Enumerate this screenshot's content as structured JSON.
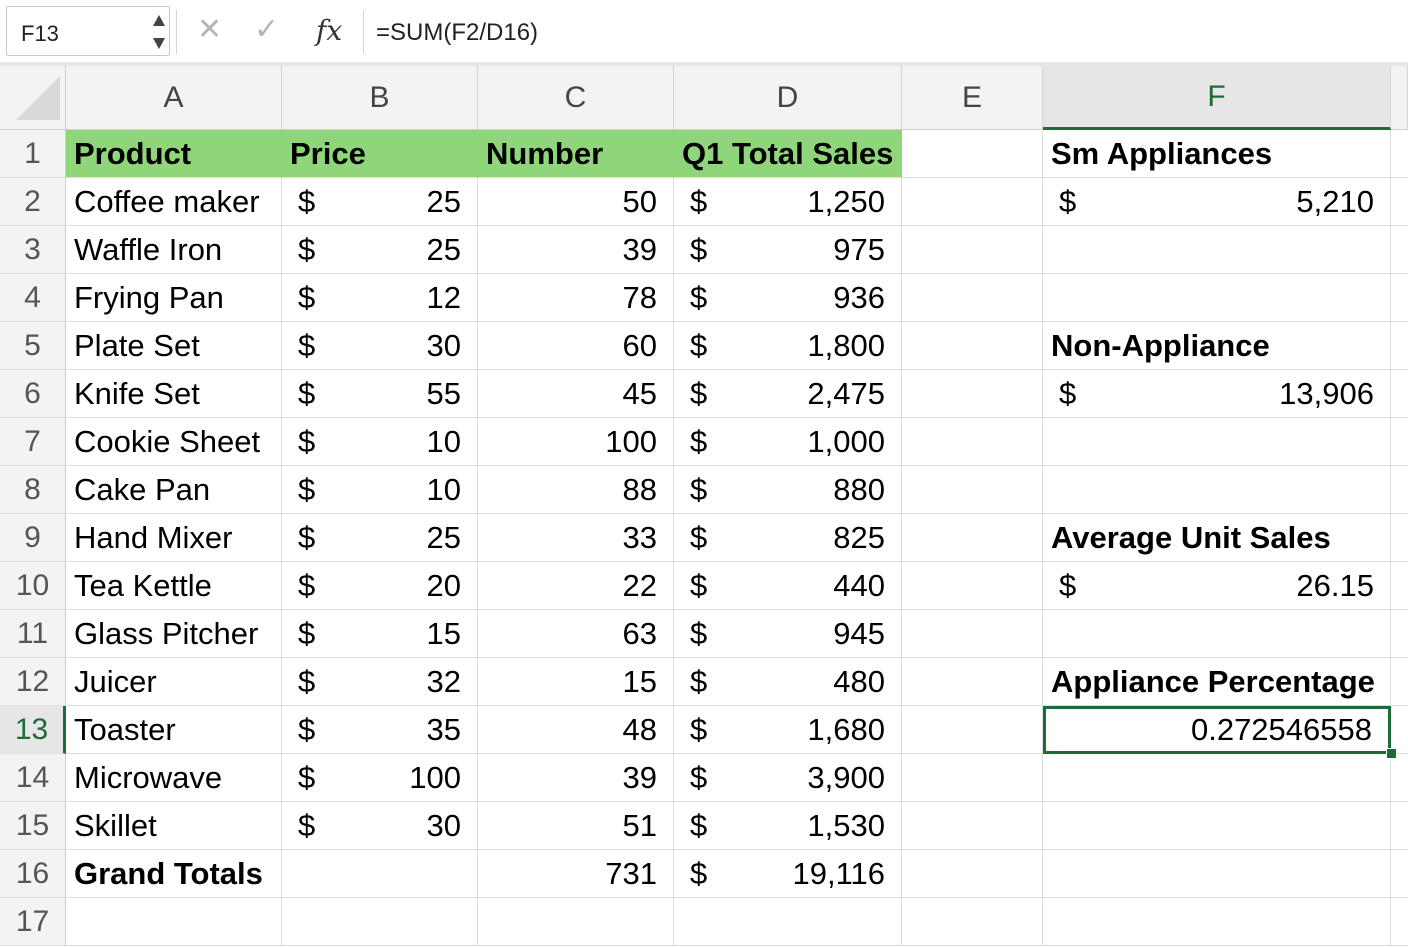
{
  "formula_bar": {
    "name_box": "F13",
    "cancel_icon": "✕",
    "confirm_icon": "✓",
    "fx_label": "fx",
    "formula": "=SUM(F2/D16)"
  },
  "columns": [
    "A",
    "B",
    "C",
    "D",
    "E",
    "F"
  ],
  "rows": [
    "1",
    "2",
    "3",
    "4",
    "5",
    "6",
    "7",
    "8",
    "9",
    "10",
    "11",
    "12",
    "13",
    "14",
    "15",
    "16",
    "17"
  ],
  "header_row": {
    "a": "Product",
    "b": "Price",
    "c": "Number",
    "d": "Q1 Total Sales"
  },
  "products": [
    {
      "name": "Coffee maker",
      "cur": "$",
      "price": "25",
      "number": "50",
      "sales": "1,250"
    },
    {
      "name": "Waffle Iron",
      "cur": "$",
      "price": "25",
      "number": "39",
      "sales": "975"
    },
    {
      "name": "Frying Pan",
      "cur": "$",
      "price": "12",
      "number": "78",
      "sales": "936"
    },
    {
      "name": "Plate Set",
      "cur": "$",
      "price": "30",
      "number": "60",
      "sales": "1,800"
    },
    {
      "name": "Knife Set",
      "cur": "$",
      "price": "55",
      "number": "45",
      "sales": "2,475"
    },
    {
      "name": "Cookie Sheet",
      "cur": "$",
      "price": "10",
      "number": "100",
      "sales": "1,000"
    },
    {
      "name": "Cake Pan",
      "cur": "$",
      "price": "10",
      "number": "88",
      "sales": "880"
    },
    {
      "name": "Hand Mixer",
      "cur": "$",
      "price": "25",
      "number": "33",
      "sales": "825"
    },
    {
      "name": "Tea Kettle",
      "cur": "$",
      "price": "20",
      "number": "22",
      "sales": "440"
    },
    {
      "name": "Glass Pitcher",
      "cur": "$",
      "price": "15",
      "number": "63",
      "sales": "945"
    },
    {
      "name": "Juicer",
      "cur": "$",
      "price": "32",
      "number": "15",
      "sales": "480"
    },
    {
      "name": "Toaster",
      "cur": "$",
      "price": "35",
      "number": "48",
      "sales": "1,680"
    },
    {
      "name": "Microwave",
      "cur": "$",
      "price": "100",
      "number": "39",
      "sales": "3,900"
    },
    {
      "name": "Skillet",
      "cur": "$",
      "price": "30",
      "number": "51",
      "sales": "1,530"
    }
  ],
  "totals": {
    "label": "Grand Totals",
    "number": "731",
    "cur": "$",
    "sales": "19,116"
  },
  "summary": {
    "sm_appliances_label": "Sm Appliances",
    "sm_appliances_cur": "$",
    "sm_appliances_value": "5,210",
    "non_appliance_label": "Non-Appliance",
    "non_appliance_cur": "$",
    "non_appliance_value": "13,906",
    "avg_unit_label": "Average Unit Sales",
    "avg_unit_cur": "$",
    "avg_unit_value": "26.15",
    "appliance_pct_label": "Appliance Percentage",
    "appliance_pct_value": "0.272546558"
  },
  "active_cell": {
    "column": "F",
    "row": "13"
  },
  "colors": {
    "header_fill": "#8fd67a",
    "selection": "#1e6b3a"
  }
}
